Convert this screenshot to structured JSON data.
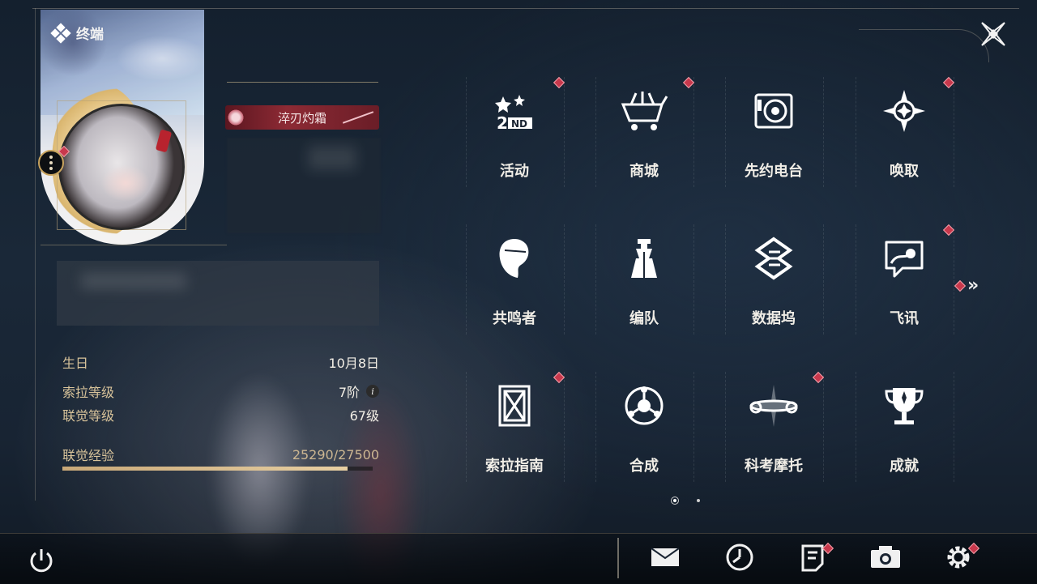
{
  "terminal": {
    "label": "终端"
  },
  "profile": {
    "title_badge": "淬刃灼霜"
  },
  "stats": {
    "birthday_label": "生日",
    "birthday_value": "10月8日",
    "sola_level_label": "索拉等级",
    "sola_level_value": "7阶",
    "union_level_label": "联觉等级",
    "union_level_value": "67级",
    "union_exp_label": "联觉经验",
    "union_exp_value": "25290/27500",
    "union_exp_progress": 0.92
  },
  "menu": {
    "items": [
      {
        "label": "活动",
        "icon": "events-2nd-icon",
        "badge": true
      },
      {
        "label": "商城",
        "icon": "shop-basket-icon",
        "badge": true
      },
      {
        "label": "先约电台",
        "icon": "radio-icon",
        "badge": false
      },
      {
        "label": "唤取",
        "icon": "convene-star-icon",
        "badge": true
      },
      {
        "label": "共鸣者",
        "icon": "resonator-head-icon",
        "badge": false
      },
      {
        "label": "编队",
        "icon": "team-chess-icon",
        "badge": false
      },
      {
        "label": "数据坞",
        "icon": "data-bank-icon",
        "badge": false
      },
      {
        "label": "飞讯",
        "icon": "message-chat-icon",
        "badge": true
      },
      {
        "label": "索拉指南",
        "icon": "guidebook-icon",
        "badge": true
      },
      {
        "label": "合成",
        "icon": "synthesis-icon",
        "badge": false
      },
      {
        "label": "科考摩托",
        "icon": "motorbike-icon",
        "badge": true
      },
      {
        "label": "成就",
        "icon": "trophy-icon",
        "badge": false
      }
    ],
    "next_glyph": "»",
    "current_page": 1,
    "page_count": 2
  },
  "bottom_bar": {
    "buttons": [
      {
        "icon": "mail-icon",
        "badge": false
      },
      {
        "icon": "clock-icon",
        "badge": false
      },
      {
        "icon": "notes-icon",
        "badge": true
      },
      {
        "icon": "camera-icon",
        "badge": false
      },
      {
        "icon": "settings-gear-icon",
        "badge": true
      }
    ]
  },
  "colors": {
    "accent_gold": "#d8c39a",
    "badge_red": "#c8384c",
    "title_red": "#8d2a34"
  }
}
